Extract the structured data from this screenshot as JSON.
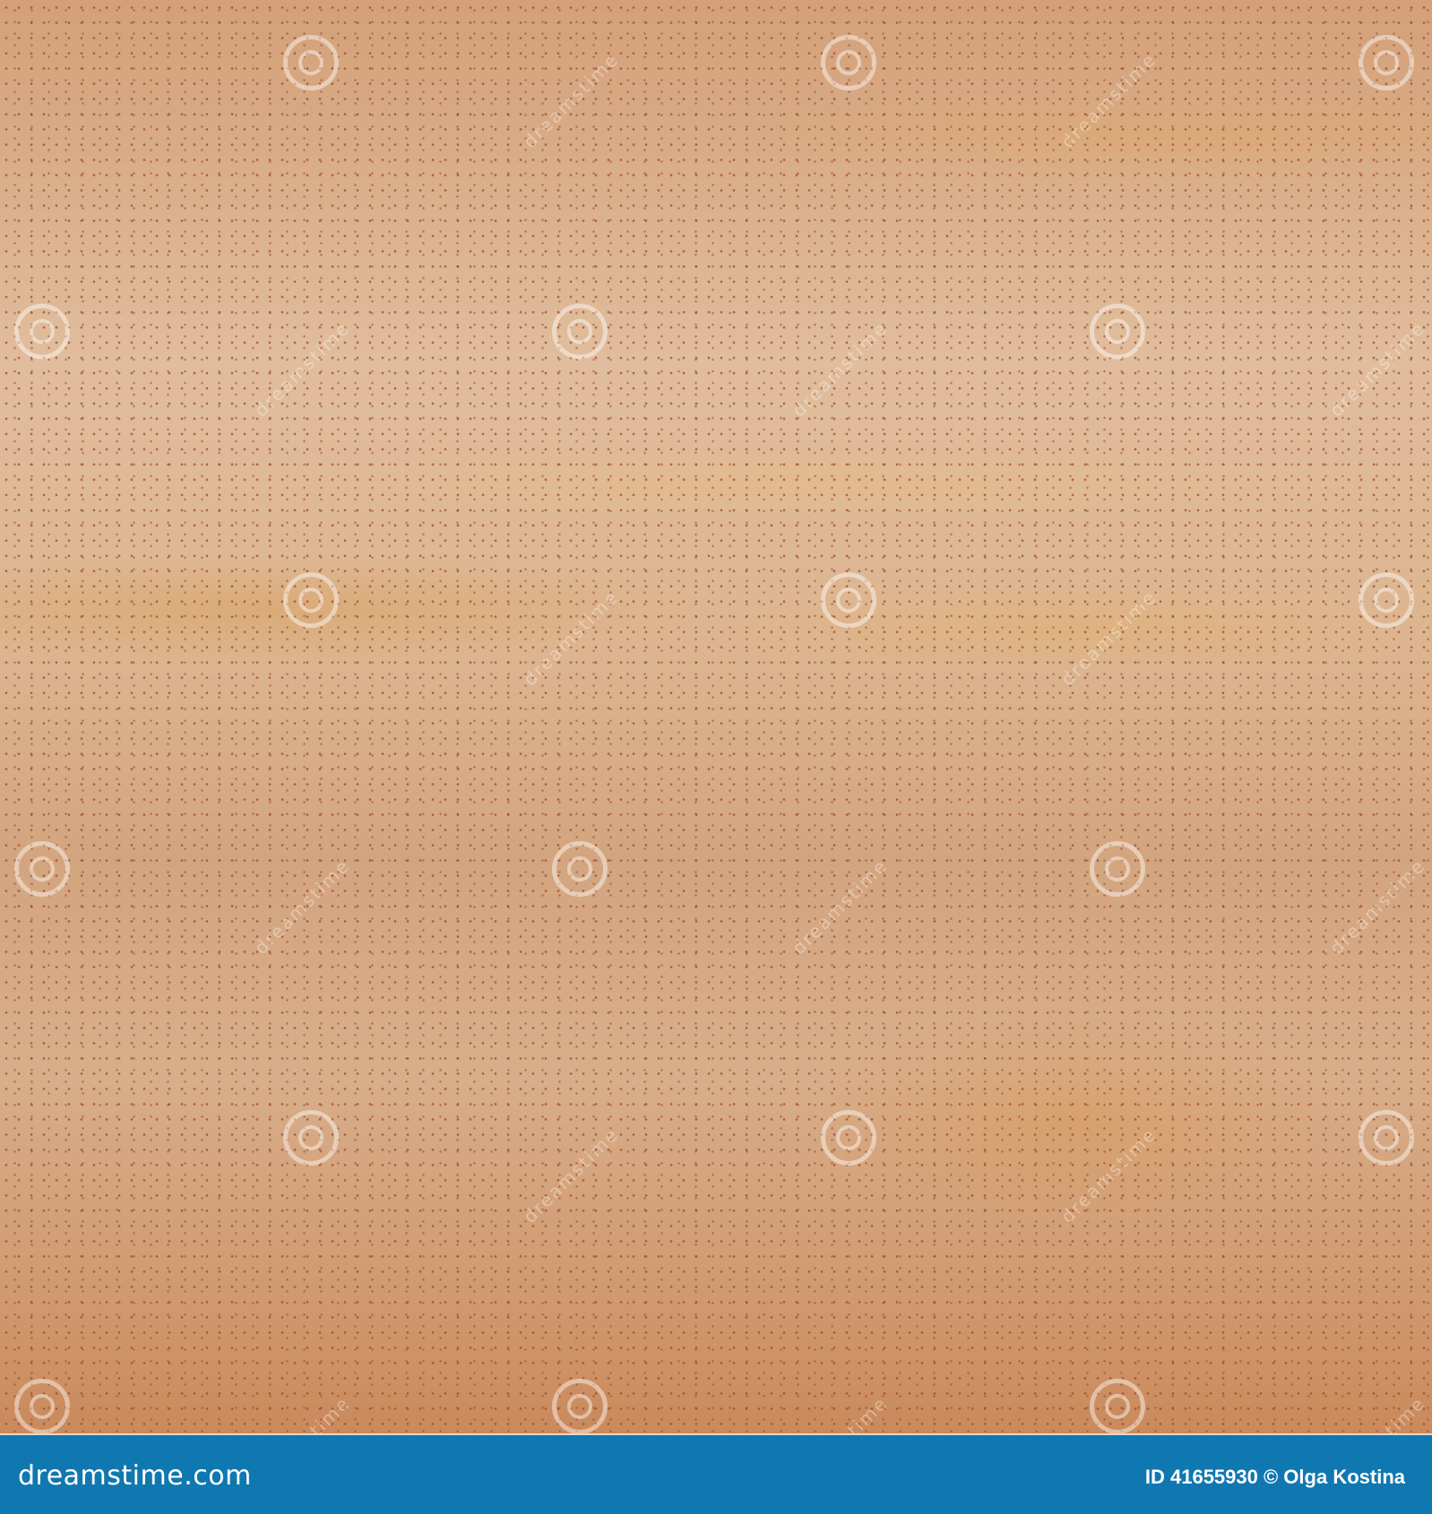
{
  "image": {
    "watermark_text": "dreamstime"
  },
  "footer": {
    "logo": "dreamstime.com",
    "credit": "ID 41655930 © Olga Kostina",
    "background_color": "#1078b0"
  }
}
